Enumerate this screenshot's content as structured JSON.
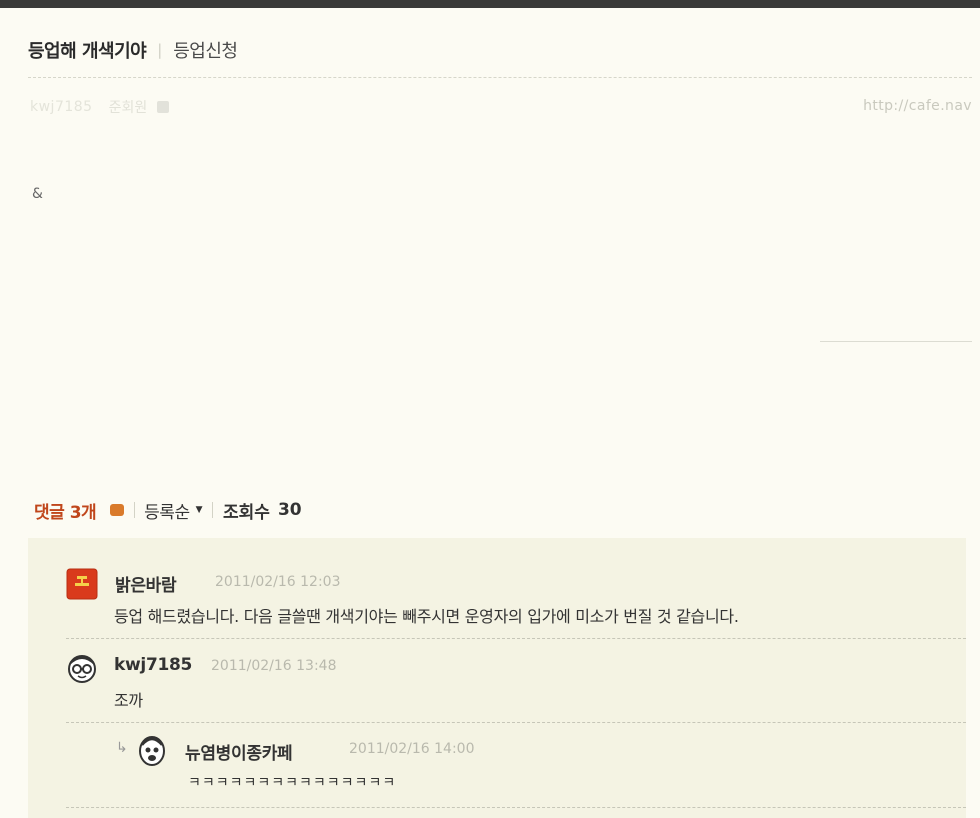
{
  "post": {
    "title": "등업해 개색기야",
    "board": "등업신청",
    "author": "kwj7185",
    "author_rank": "준회원",
    "url": "http://cafe.nav",
    "body": "&"
  },
  "comments_bar": {
    "label": "댓글",
    "count": "3개",
    "sort": "등록순",
    "views_label": "조회수",
    "views_value": "30"
  },
  "comments": [
    {
      "author": "밝은바람",
      "date": "2011/02/16 12:03",
      "text": "등업 해드렸습니다. 다음 글쓸땐 개색기야는 빼주시면 운영자의 입가에 미소가 번질 것 같습니다.",
      "avatar": "red-badge-icon"
    },
    {
      "author": "kwj7185",
      "date": "2011/02/16 13:48",
      "text": "조까",
      "avatar": "glasses-face-icon"
    },
    {
      "author": "뉴염병이종카페",
      "date": "2011/02/16 14:00",
      "text": "ㅋㅋㅋㅋㅋㅋㅋㅋㅋㅋㅋㅋㅋㅋㅋ",
      "avatar": "face-icon",
      "is_reply": true
    }
  ],
  "colors": {
    "accent": "#c0461b",
    "comment_bg": "#f4f3e3",
    "page_bg": "#fcfbf3"
  }
}
